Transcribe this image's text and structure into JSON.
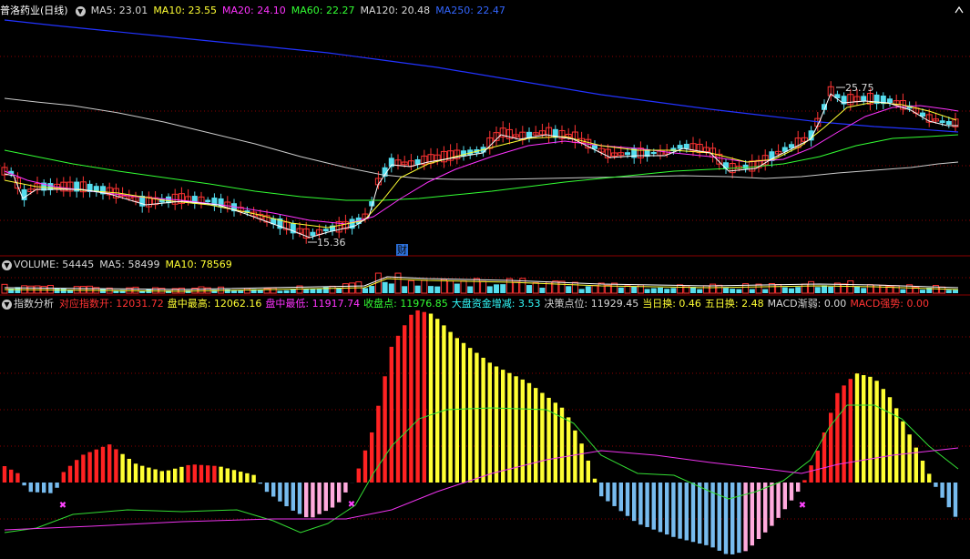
{
  "main": {
    "stock_title": "普洛药业(日线)",
    "ma5": "MA5: 23.01",
    "ma10": "MA10: 23.55",
    "ma20": "MA20: 24.10",
    "ma60": "MA60: 22.27",
    "ma120": "MA120: 20.48",
    "ma250": "MA250: 22.47",
    "high_label": "25.75",
    "low_label": "15.36",
    "event_marker": "财"
  },
  "volume": {
    "label": "VOLUME: 54445",
    "ma5": "MA5: 58499",
    "ma10": "MA10: 78569"
  },
  "indicator": {
    "name": "指数分析",
    "items": [
      {
        "label": "对应指数开: ",
        "value": "12031.72",
        "color": "#ff3333"
      },
      {
        "label": "盘中最高: ",
        "value": "12062.16",
        "color": "#ffff33"
      },
      {
        "label": "盘中最低: ",
        "value": "11917.74",
        "color": "#ff33ff"
      },
      {
        "label": "收盘点: ",
        "value": "11976.85",
        "color": "#33ff33"
      },
      {
        "label": "大盘资金增减: ",
        "value": "3.53",
        "color": "#33ffff"
      },
      {
        "label": "决策点位: ",
        "value": "11929.45",
        "color": "#d8d8d8"
      },
      {
        "label": "当日换: ",
        "value": "0.46",
        "color": "#ffff33"
      },
      {
        "label": "五日换: ",
        "value": "2.48",
        "color": "#ffff33"
      },
      {
        "label": "MACD渐弱: ",
        "value": "0.00",
        "color": "#d8d8d8"
      },
      {
        "label": "MACD强势: ",
        "value": "0.00",
        "color": "#ff3333"
      }
    ]
  },
  "colors": {
    "up": "#ff3333",
    "down": "#55ddee",
    "ma5": "#ffffff",
    "ma10": "#ffff33",
    "ma20": "#ff33ff",
    "ma60": "#33ff33",
    "ma120": "#cccccc",
    "ma250": "#2233ff",
    "bar_red": "#ff2222",
    "bar_yellow": "#ffff33",
    "bar_blue": "#77bbee",
    "bar_pink": "#ffaadd",
    "grid": "#8b0000"
  }
}
